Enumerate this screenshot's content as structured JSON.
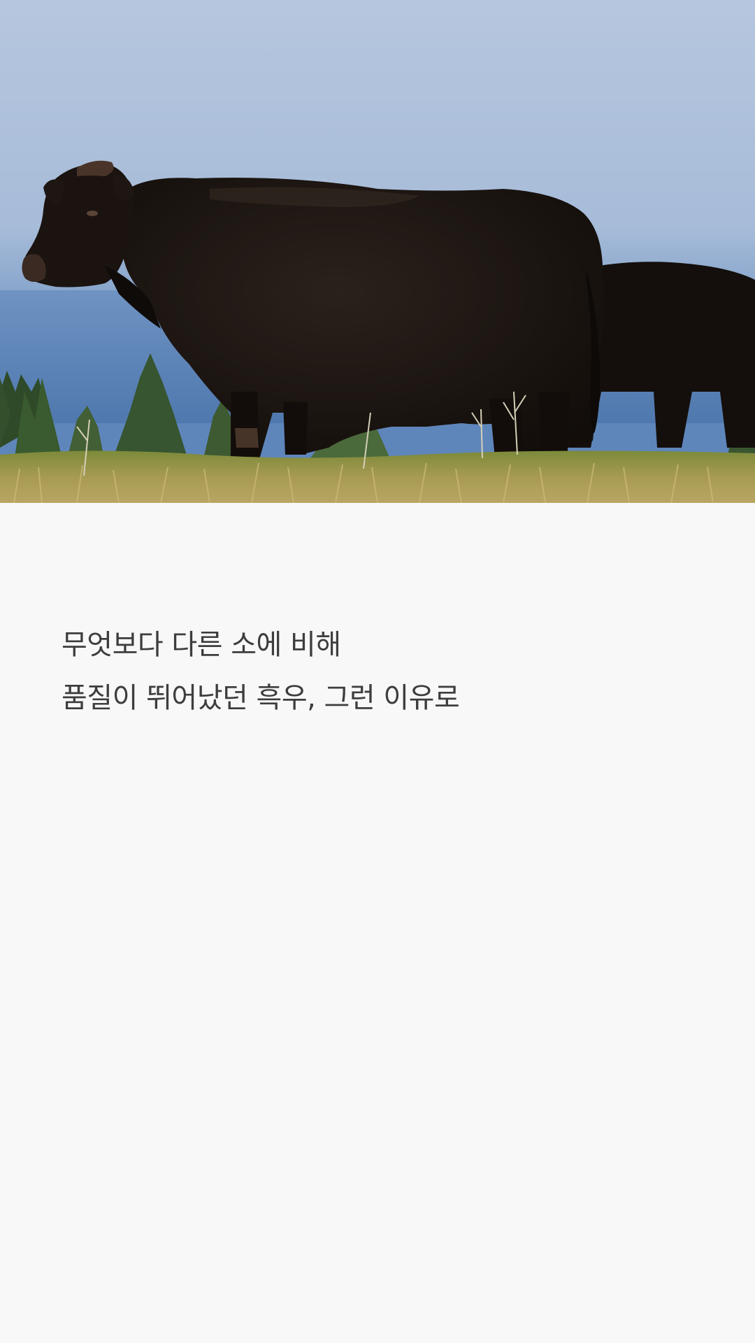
{
  "caption": {
    "line1": "무엇보다 다른 소에 비해",
    "line2": "품질이 뛰어났던 흑우, 그런 이유로"
  },
  "colors": {
    "background": "#f8f8f8",
    "text": "#3d3d3d"
  },
  "image": {
    "subject": "black-cattle-in-pasture"
  }
}
